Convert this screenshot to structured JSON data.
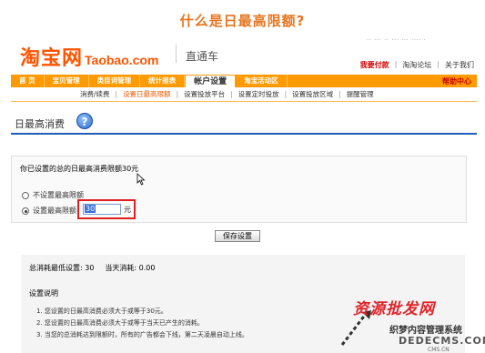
{
  "headline": "什么是日最高限额?",
  "brand": {
    "logo_cn": "淘宝网",
    "logo_en": "Taobao.com",
    "product": "直通车",
    "top_right_cut": "·· ··· ·· ··· ··· ···· ·"
  },
  "toplinks": {
    "recharge": "我要付款",
    "forum": "淘淘论坛",
    "about": "关于我们"
  },
  "nav": {
    "items": [
      "首 页",
      "宝贝管理",
      "类目词管理",
      "统计报表",
      "帐户设置",
      "淘宝活动区"
    ],
    "active_index": 4,
    "help": "帮助中心"
  },
  "subnav": {
    "items": [
      "消费/续费",
      "设置日最高限额",
      "设置投放平台",
      "设置定时投放",
      "设置投放区域",
      "提醒管理"
    ],
    "active_index": 1
  },
  "section": {
    "title": "日最高消费",
    "help_icon": "?"
  },
  "form": {
    "heading": "你已设置的总的日最高消费限额30元",
    "option_none": "不设置最高限额",
    "option_set": "设置最高限额",
    "amount_value": "30",
    "unit": "元",
    "save_label": "保存设置"
  },
  "info": {
    "min_setting": "总消耗最低设置: 30",
    "today_spend": "当天消耗: 0.00",
    "notes_title": "设置说明",
    "notes": [
      "1.  您设置的日最高消费必须大于或等于30元。",
      "2.  您设置的日最高消费必须大于或等于当天已产生的消耗。",
      "3.  当您的总消耗达到限额时，所有的广告都会下线，第二天凌晨自动上线。"
    ]
  },
  "watermark": {
    "line1": "资源批发网",
    "line2": "织梦内容管理系统",
    "line3": "DEDECMS.COM",
    "line4": "CMS.CN"
  },
  "colors": {
    "accent": "#ff9a00",
    "brand": "#ff5500",
    "link_blue": "#1d5fb8",
    "alert": "#e02020"
  }
}
